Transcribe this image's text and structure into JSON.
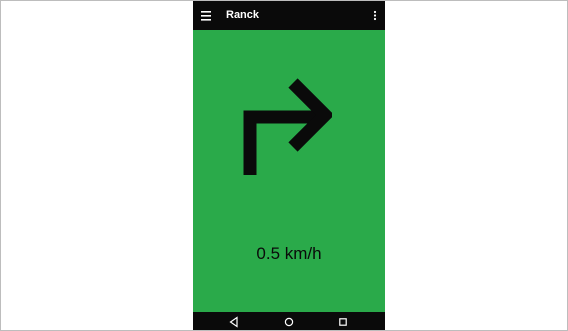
{
  "app_bar": {
    "title": "Ranck",
    "menu_icon": "hamburger-menu-icon",
    "overflow_icon": "more-vert-icon",
    "background": "#0a0a0a"
  },
  "main": {
    "background": "#2aaa4a",
    "direction_icon": "turn-right-arrow-icon",
    "speed": "0.5 km/h"
  },
  "nav_bar": {
    "back_icon": "back-triangle-icon",
    "home_icon": "home-circle-icon",
    "recents_icon": "recents-square-icon"
  }
}
